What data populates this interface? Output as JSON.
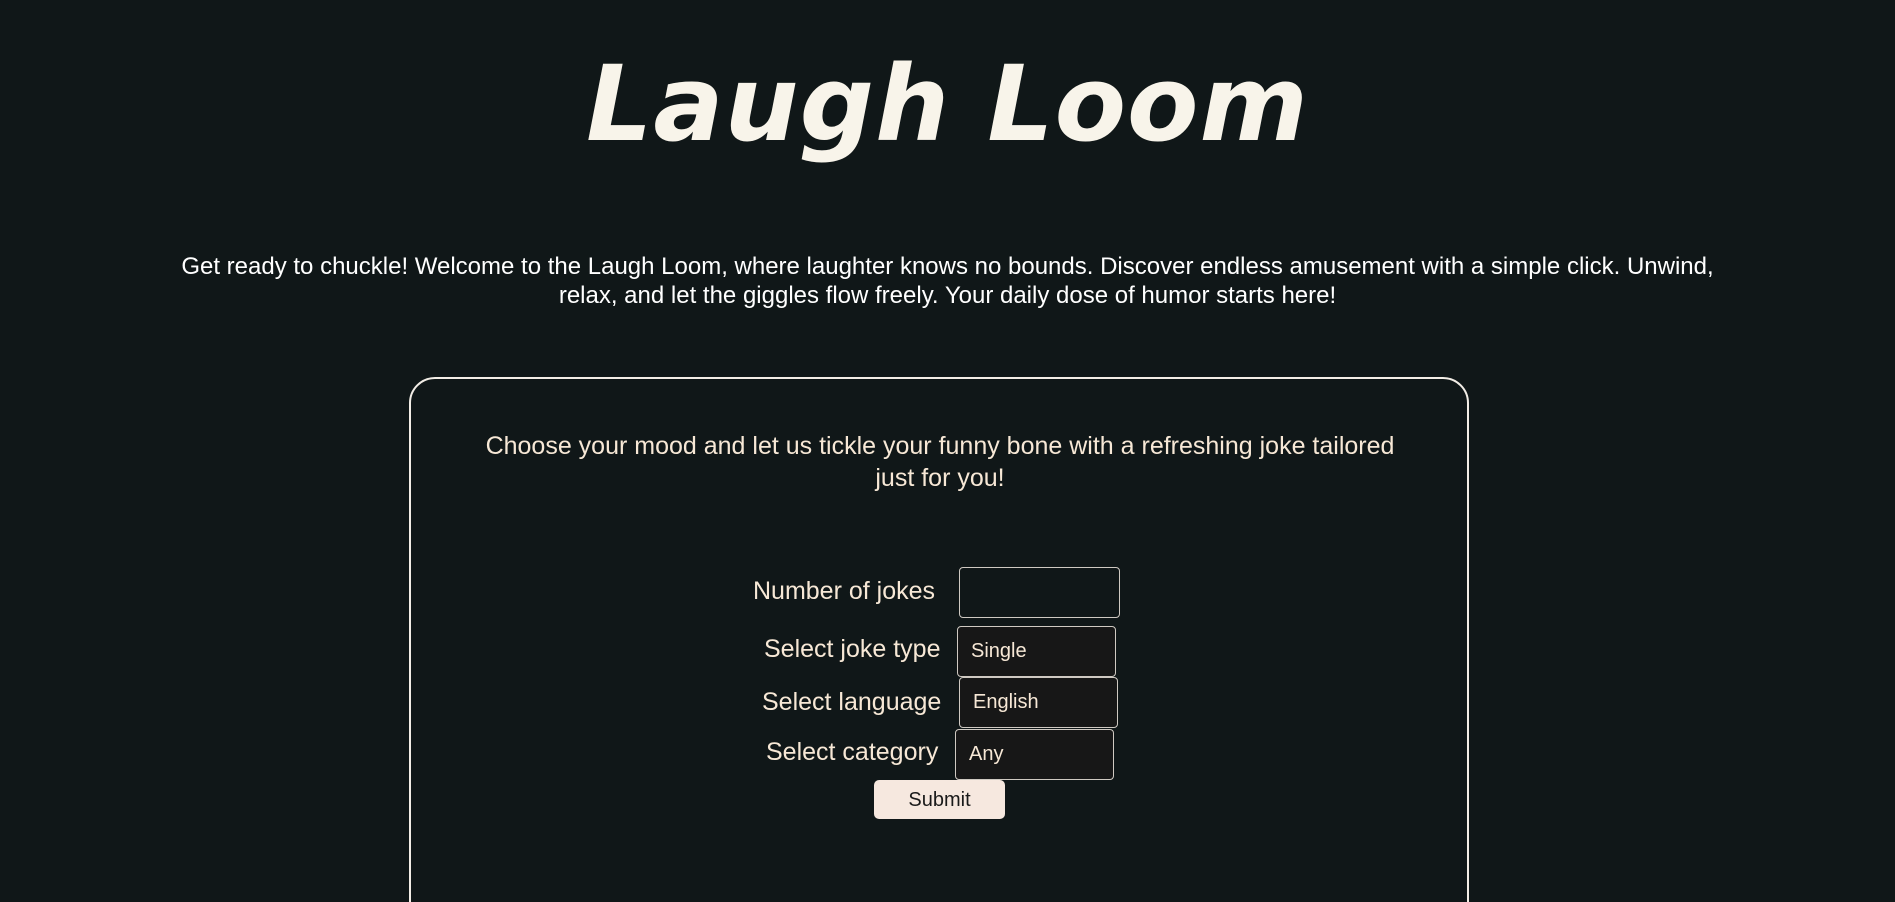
{
  "header": {
    "title": "Laugh Loom"
  },
  "intro": {
    "text": "Get ready to chuckle! Welcome to the Laugh Loom, where laughter knows no bounds. Discover endless amusement with a simple click. Unwind, relax, and let the giggles flow freely. Your daily dose of humor starts here!"
  },
  "card": {
    "subtitle": "Choose your mood and let us tickle your funny bone with a refreshing joke tailored just for you!"
  },
  "form": {
    "jokes_count_label": "Number of jokes",
    "jokes_count_value": "",
    "joke_type_label": "Select joke type",
    "joke_type_value": "Single",
    "language_label": "Select language",
    "language_value": "English",
    "category_label": "Select category",
    "category_value": "Any",
    "submit_label": "Submit"
  },
  "colors": {
    "background": "#101718",
    "text": "#f7e8d6",
    "button": "#f6e8df"
  }
}
